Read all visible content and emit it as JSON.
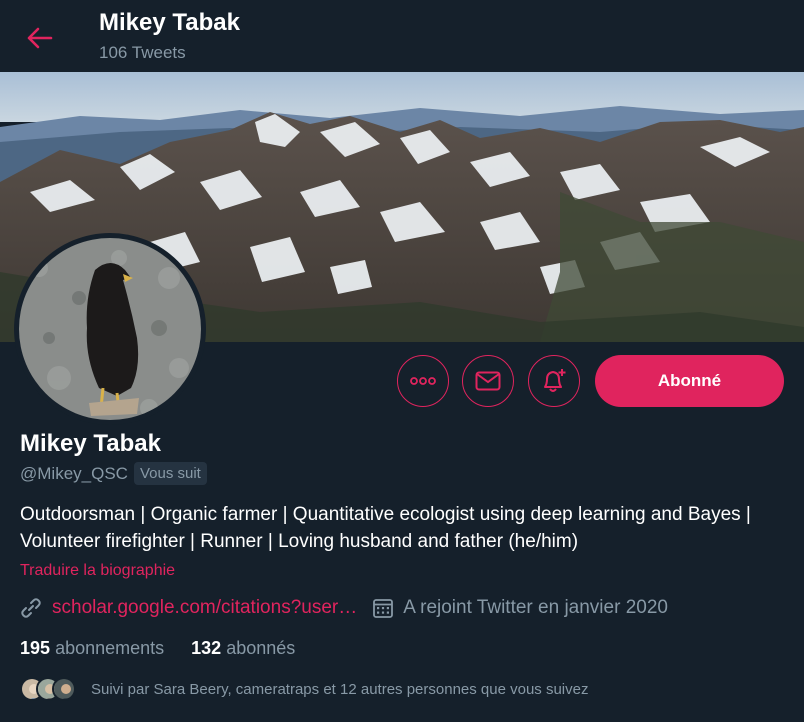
{
  "header": {
    "name": "Mikey Tabak",
    "tweet_count": "106 Tweets"
  },
  "profile": {
    "name": "Mikey Tabak",
    "handle": "@Mikey_QSC",
    "follows_you": "Vous suit",
    "bio": "Outdoorsman | Organic farmer | Quantitative ecologist using deep learning and Bayes | Volunteer firefighter | Runner | Loving husband and father (he/him)",
    "translate_bio": "Traduire la biographie",
    "website": "scholar.google.com/citations?user…",
    "joined": "A rejoint Twitter en janvier 2020"
  },
  "actions": {
    "follow_label": "Abonné"
  },
  "stats": {
    "following_count": "195",
    "following_label": "abonnements",
    "followers_count": "132",
    "followers_label": "abonnés"
  },
  "followed_by": "Suivi par Sara Beery, cameratraps et 12 autres personnes que vous suivez",
  "colors": {
    "accent": "#e0245e",
    "background": "#15202b",
    "secondary_text": "#8899a6"
  }
}
